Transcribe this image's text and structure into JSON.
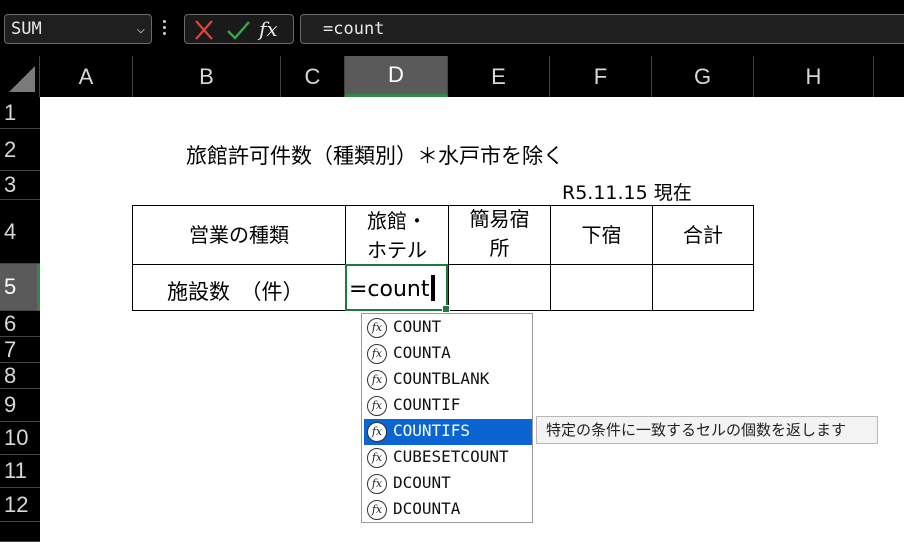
{
  "formula_bar": {
    "name_box": "SUM",
    "fx_label": "fx",
    "formula": "=count"
  },
  "columns": [
    "A",
    "B",
    "C",
    "D",
    "E",
    "F",
    "G",
    "H"
  ],
  "rows": [
    "1",
    "2",
    "3",
    "4",
    "5",
    "6",
    "7",
    "8",
    "9",
    "10",
    "11",
    "12"
  ],
  "sheet": {
    "title": "旅館許可件数（種類別）＊水戸市を除く",
    "date": "R5.11.15 現在",
    "header_row": {
      "type": "営業の種類",
      "ryokan_line1": "旅館・",
      "ryokan_line2": "ホテル",
      "kan_line1": "簡易宿",
      "kan_line2": "所",
      "geshuku": "下宿",
      "total": "合計"
    },
    "data_row": {
      "label": "施設数　（件）",
      "editing_value": "=count"
    }
  },
  "autocomplete": {
    "items": [
      "COUNT",
      "COUNTA",
      "COUNTBLANK",
      "COUNTIF",
      "COUNTIFS",
      "CUBESETCOUNT",
      "DCOUNT",
      "DCOUNTA"
    ],
    "selected": "COUNTIFS",
    "icon_label": "fx",
    "tooltip": "特定の条件に一致するセルの個数を返します"
  },
  "colors": {
    "selection_green": "#1f7a3f",
    "autocomplete_highlight": "#0a64d2",
    "chrome_bg": "#000000"
  }
}
